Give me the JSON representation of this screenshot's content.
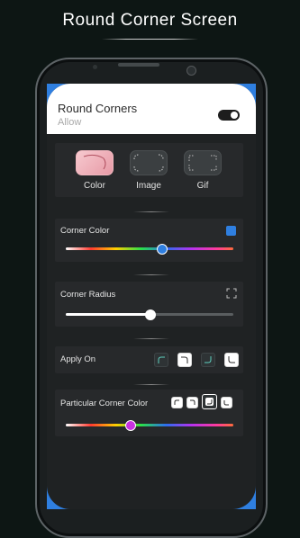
{
  "promo": {
    "title": "Round Corner Screen"
  },
  "header": {
    "title": "Round Corners",
    "subtitle": "Allow",
    "toggle_on": true
  },
  "modes": [
    {
      "label": "Color",
      "icon": "color-mode-icon",
      "active": true
    },
    {
      "label": "Image",
      "icon": "image-mode-icon",
      "active": false
    },
    {
      "label": "Gif",
      "icon": "gif-mode-icon",
      "active": false
    }
  ],
  "corner_color": {
    "label": "Corner Color",
    "swatch": "#2f7fe0",
    "slider_value": 0.57,
    "knob_color": "#2f7fe0"
  },
  "corner_radius": {
    "label": "Corner Radius",
    "slider_value": 0.5
  },
  "apply_on": {
    "label": "Apply On",
    "corners": [
      {
        "icon": "top-left-corner-icon",
        "selected": false
      },
      {
        "icon": "top-right-corner-icon",
        "selected": true
      },
      {
        "icon": "bottom-right-corner-icon",
        "selected": false
      },
      {
        "icon": "bottom-left-corner-icon",
        "selected": true
      }
    ]
  },
  "particular_corner_color": {
    "label": "Particular Corner Color",
    "corners": [
      {
        "icon": "top-left-corner-icon",
        "style": "light"
      },
      {
        "icon": "top-right-corner-icon",
        "style": "light"
      },
      {
        "icon": "bottom-right-corner-icon",
        "style": "dark"
      },
      {
        "icon": "bottom-left-corner-icon",
        "style": "light"
      }
    ],
    "slider_value": 0.38,
    "knob_color": "#c832e0"
  },
  "colors": {
    "accent": "#2f7fe0",
    "background": "#0d1614"
  }
}
